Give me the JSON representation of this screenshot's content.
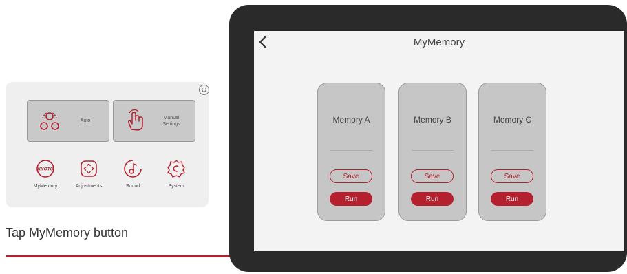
{
  "mini_home": {
    "tiles": [
      {
        "label": "Auto",
        "icon": "auto-icon"
      },
      {
        "label": "Manual\nSettings",
        "icon": "hand-icon"
      }
    ],
    "icons": [
      {
        "label": "MyMemory",
        "icon": "kyoto-logo-icon"
      },
      {
        "label": "Adjustments",
        "icon": "adjust-icon"
      },
      {
        "label": "Sound",
        "icon": "sound-icon"
      },
      {
        "label": "System",
        "icon": "system-gear-icon"
      }
    ],
    "logo_text": "KYOTO"
  },
  "caption": "Tap MyMemory button",
  "screen": {
    "title": "MyMemory",
    "cards": [
      {
        "name": "Memory A",
        "save": "Save",
        "run": "Run"
      },
      {
        "name": "Memory B",
        "save": "Save",
        "run": "Run"
      },
      {
        "name": "Memory C",
        "save": "Save",
        "run": "Run"
      }
    ]
  },
  "colors": {
    "accent": "#b5202e",
    "card": "#c6c6c6",
    "bezel": "#2a2a2a",
    "screen_bg": "#f3f3f3"
  }
}
